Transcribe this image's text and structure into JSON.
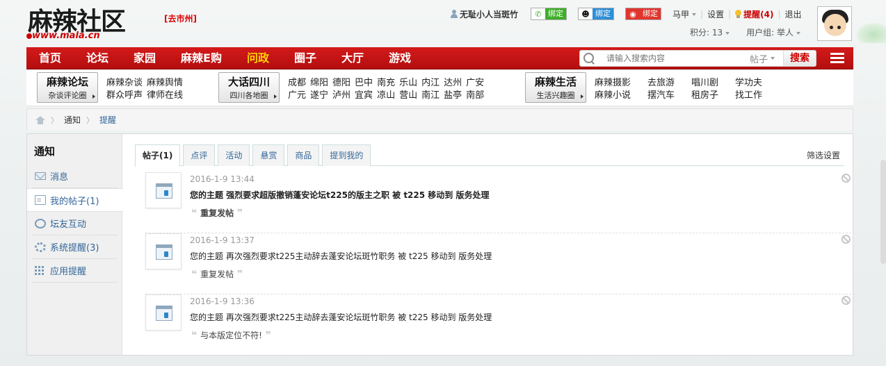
{
  "header": {
    "logo_text": "麻辣社区",
    "logo_url": "www.mala.cn",
    "city_link": "[去市州]",
    "username": "无耻小人当斑竹",
    "bind_wechat": "绑定",
    "bind_qq": "绑定",
    "bind_weibo": "绑定",
    "menu_majia": "马甲",
    "menu_settings": "设置",
    "menu_remind": "提醒(4)",
    "menu_logout": "退出",
    "points": "积分: 13",
    "usergroup": "用户组: 举人"
  },
  "nav": {
    "items": [
      "首页",
      "论坛",
      "家园",
      "麻辣E购",
      "问政",
      "圈子",
      "大厅",
      "游戏"
    ],
    "active_index": 4
  },
  "search": {
    "placeholder": "请输入搜索内容",
    "scope": "帖子",
    "button": "搜索"
  },
  "channels": [
    {
      "title": "麻辣论坛",
      "subtitle": "杂谈评论圈",
      "links": [
        "麻辣杂谈",
        "群众呼声",
        "麻辣舆情",
        "律师在线"
      ]
    },
    {
      "title": "大话四川",
      "subtitle": "四川各地圈",
      "links": [
        "成都",
        "广元",
        "绵阳",
        "遂宁",
        "德阳",
        "泸州",
        "巴中",
        "宜宾",
        "南充",
        "凉山",
        "乐山",
        "营山",
        "内江",
        "南江",
        "达州",
        "盐亭",
        "广安",
        "南部"
      ]
    },
    {
      "title": "麻辣生活",
      "subtitle": "生活兴趣圈",
      "links": [
        "麻辣摄影",
        "麻辣小说",
        "去旅游",
        "摆汽车",
        "唱川剧",
        "租房子",
        "学功夫",
        "找工作"
      ]
    }
  ],
  "breadcrumb": {
    "level1": "通知",
    "level2": "提醒"
  },
  "sidebar": {
    "title": "通知",
    "items": [
      {
        "label": "消息",
        "icon": "mail-icon"
      },
      {
        "label": "我的帖子(1)",
        "icon": "document-icon"
      },
      {
        "label": "坛友互动",
        "icon": "recycle-icon"
      },
      {
        "label": "系统提醒(3)",
        "icon": "gear-icon"
      },
      {
        "label": "应用提醒",
        "icon": "grid-icon"
      }
    ],
    "active_index": 1
  },
  "tabs": {
    "items": [
      "帖子(1)",
      "点评",
      "活动",
      "悬赏",
      "商品",
      "提到我的"
    ],
    "active_index": 0,
    "filter": "筛选设置"
  },
  "notices": [
    {
      "time": "2016-1-9 13:44",
      "text": "您的主题 强烈要求超版撤销蓬安论坛t225的版主之职 被 t225 移动到 版务处理",
      "quote": "重复发帖",
      "unread": true
    },
    {
      "time": "2016-1-9 13:37",
      "text": "您的主题 再次强烈要求t225主动辞去蓬安论坛斑竹职务 被 t225 移动到 版务处理",
      "quote": "重复发帖",
      "unread": false
    },
    {
      "time": "2016-1-9 13:36",
      "text": "您的主题 再次强烈要求t225主动辞去蓬安论坛斑竹职务 被 t225 移动到 版务处理",
      "quote": "与本版定位不符!",
      "unread": false
    }
  ],
  "colors": {
    "nav_red": "#c41212",
    "nav_active": "#ffd200",
    "link_blue": "#336699",
    "wechat_green": "#3fae29",
    "qq_blue": "#2d8fd8",
    "weibo_red": "#e0352d"
  }
}
